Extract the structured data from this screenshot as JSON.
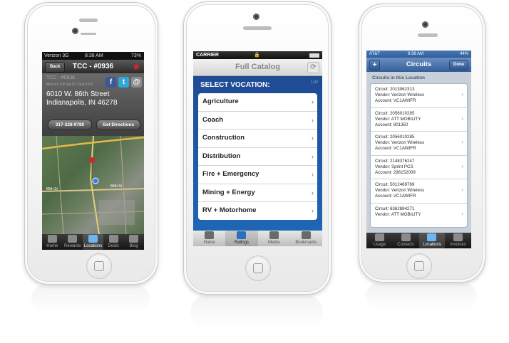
{
  "phone1": {
    "status": {
      "carrier": "Verizon 3G",
      "time": "8:38 AM",
      "battery": "73%"
    },
    "nav": {
      "back_label": "Back",
      "title": "TCC - #0936",
      "favorite_icon": "star-icon"
    },
    "info": {
      "store_name": "TCC - #0936",
      "hours": "Mon-Fri 9-8 Sat 9-7 Sun 10-5",
      "address_line1": "6010 W. 86th Street",
      "address_line2": "Indianapolis, IN 46278",
      "phone_button": "317-228-9780",
      "directions_button": "Get Directions",
      "social": [
        {
          "icon": "facebook-icon",
          "glyph": "f",
          "color": "#3b5998"
        },
        {
          "icon": "twitter-icon",
          "glyph": "t",
          "color": "#2fa7dc"
        },
        {
          "icon": "email-icon",
          "glyph": "@",
          "color": "#8c8c8c"
        }
      ]
    },
    "map": {
      "street_label": "86th St",
      "street_label2": "86th St"
    },
    "tabs": [
      {
        "label": "Home",
        "icon": "home-icon",
        "active": false
      },
      {
        "label": "Rewards",
        "icon": "rewards-icon",
        "active": false
      },
      {
        "label": "Locations",
        "icon": "locations-icon",
        "active": true
      },
      {
        "label": "Deals",
        "icon": "deals-icon",
        "active": false
      },
      {
        "label": "Blog",
        "icon": "blog-icon",
        "active": false
      }
    ]
  },
  "phone2": {
    "status": {
      "carrier": "CARRIER"
    },
    "nav": {
      "title": "Full Catalog",
      "refresh_icon": "refresh-icon"
    },
    "heading": "SELECT VOCATION:",
    "version": "1.02",
    "items": [
      "Agriculture",
      "Coach",
      "Construction",
      "Distribution",
      "Fire + Emergency",
      "Mining + Energy",
      "RV + Motorhome"
    ],
    "tabs": [
      {
        "label": "Home",
        "icon": "home-icon",
        "active": false
      },
      {
        "label": "Ratings",
        "icon": "ratings-icon",
        "active": true
      },
      {
        "label": "Media",
        "icon": "media-icon",
        "active": false
      },
      {
        "label": "Bookmarks",
        "icon": "bookmarks-icon",
        "active": false
      }
    ]
  },
  "phone3": {
    "status": {
      "carrier": "AT&T",
      "time": "9:38 AM",
      "battery": "44%"
    },
    "nav": {
      "title": "Circuits",
      "add_label": "+",
      "done_label": "Done"
    },
    "section_title": "Circuits in this Location",
    "circuits": [
      {
        "circuit": "Circuit: 2013062313",
        "vendor": "Vendor: Verizon Wireless",
        "account": "Account: VC1AWIFR"
      },
      {
        "circuit": "Circuit: 2056010285",
        "vendor": "Vendor: ATT MOBILITY",
        "account": "Account: 801350"
      },
      {
        "circuit": "Circuit: 2056010285",
        "vendor": "Vendor: Verizon Wireless",
        "account": "Account: VC1AWIFR"
      },
      {
        "circuit": "Circuit: 2148376247",
        "vendor": "Vendor: Sprint PCS",
        "account": "Account: 296152009"
      },
      {
        "circuit": "Circuit: 5012469769",
        "vendor": "Vendor: Verizon Wireless",
        "account": "Account: VC1AWIFR"
      },
      {
        "circuit": "Circuit: 6362884271",
        "vendor": "Vendor: ATT MOBILITY",
        "account": ""
      }
    ],
    "tabs": [
      {
        "label": "Usage",
        "icon": "usage-icon",
        "active": false
      },
      {
        "label": "Contacts",
        "icon": "contacts-icon",
        "active": false
      },
      {
        "label": "Locations",
        "icon": "locations-icon",
        "active": true
      },
      {
        "label": "Invoices",
        "icon": "invoices-icon",
        "active": false
      }
    ]
  }
}
